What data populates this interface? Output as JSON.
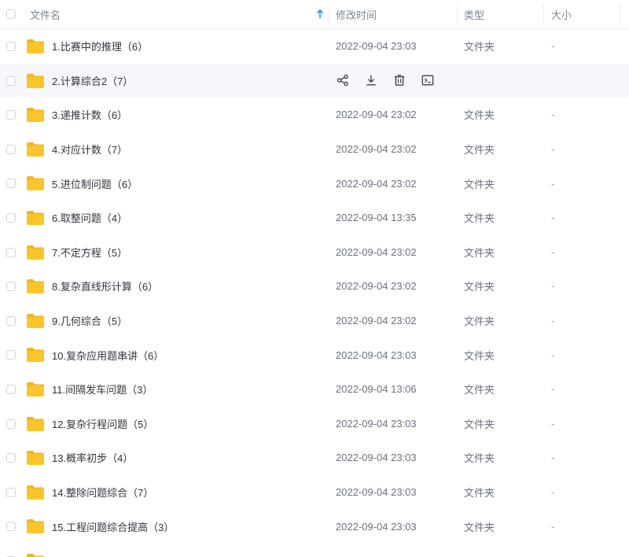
{
  "header": {
    "name": "文件名",
    "modified": "修改时间",
    "type": "类型",
    "size": "大小"
  },
  "colors": {
    "folder": "#f8c52c",
    "folder_tab": "#f3b519",
    "sort_arrow": "#1e90ff",
    "hover_row": "#f6f7fa"
  },
  "icons": {
    "folder": "folder-icon",
    "sort": "sort-ascending-icon",
    "share": "share-icon",
    "download": "download-icon",
    "delete": "trash-icon",
    "more": "terminal-icon"
  },
  "rows": [
    {
      "name": "1.比赛中的推理（6）",
      "time": "2022-09-04 23:03",
      "type": "文件夹",
      "size": "-"
    },
    {
      "name": "2.计算综合2（7）",
      "time": "",
      "type": "",
      "size": "",
      "hover": true
    },
    {
      "name": "3.递推计数（6）",
      "time": "2022-09-04 23:02",
      "type": "文件夹",
      "size": "-"
    },
    {
      "name": "4.对应计数（7）",
      "time": "2022-09-04 23:02",
      "type": "文件夹",
      "size": "-"
    },
    {
      "name": "5.进位制问题（6）",
      "time": "2022-09-04 23:02",
      "type": "文件夹",
      "size": "-"
    },
    {
      "name": "6.取整问题（4）",
      "time": "2022-09-04 13:35",
      "type": "文件夹",
      "size": "-"
    },
    {
      "name": "7.不定方程（5）",
      "time": "2022-09-04 23:02",
      "type": "文件夹",
      "size": "-"
    },
    {
      "name": "8.复杂直线形计算（6）",
      "time": "2022-09-04 23:02",
      "type": "文件夹",
      "size": "-"
    },
    {
      "name": "9.几何综合（5）",
      "time": "2022-09-04 23:02",
      "type": "文件夹",
      "size": "-"
    },
    {
      "name": "10.复杂应用题串讲（6）",
      "time": "2022-09-04 23:03",
      "type": "文件夹",
      "size": "-"
    },
    {
      "name": "11.间隔发车问题（3）",
      "time": "2022-09-04 13:06",
      "type": "文件夹",
      "size": "-"
    },
    {
      "name": "12.复杂行程问题（5）",
      "time": "2022-09-04 23:03",
      "type": "文件夹",
      "size": "-"
    },
    {
      "name": "13.概率初步（4）",
      "time": "2022-09-04 23:03",
      "type": "文件夹",
      "size": "-"
    },
    {
      "name": "14.整除问题综合（7）",
      "time": "2022-09-04 23:03",
      "type": "文件夹",
      "size": "-"
    },
    {
      "name": "15.工程问题综合提高（3）",
      "time": "2022-09-04 23:03",
      "type": "文件夹",
      "size": "-"
    },
    {
      "name": "",
      "time": "",
      "type": "",
      "size": ""
    }
  ]
}
